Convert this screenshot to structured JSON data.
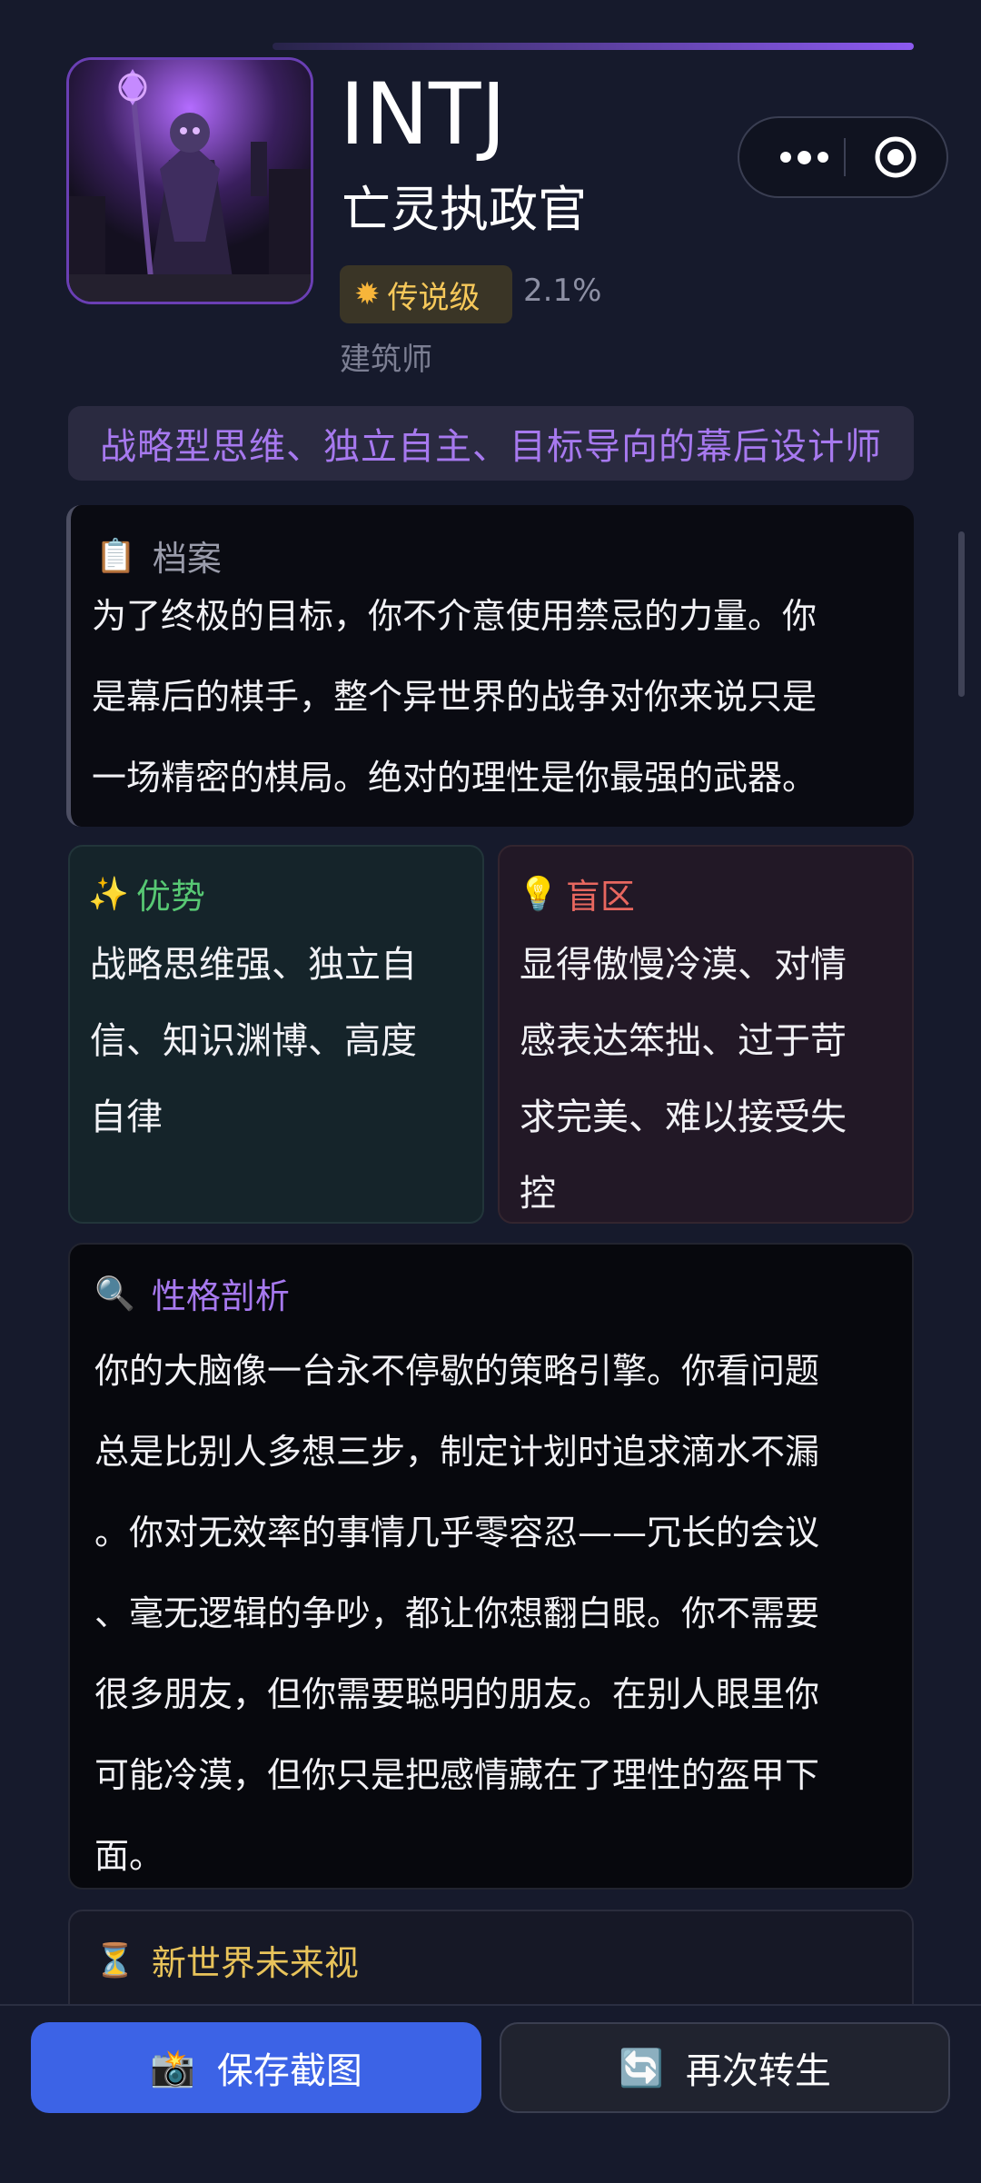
{
  "header": {
    "mbti": "INTJ",
    "title": "亡灵执政官",
    "rarity": {
      "icon": "sun-icon",
      "label": "传说级",
      "color": "#f6c85a"
    },
    "percent": "2.1%",
    "alias": "建筑师"
  },
  "capsule": {
    "more_icon": "more-dots-icon",
    "close_icon": "target-circle-icon"
  },
  "summary": "战略型思维、独立自主、目标导向的幕后设计师",
  "profile": {
    "icon": "📋",
    "title": "档案",
    "lines": [
      "为了终极的目标，你不介意使用禁忌的力量。你",
      "是幕后的棋手，整个异世界的战争对你来说只是",
      "一场精密的棋局。绝对的理性是你最强的武器。"
    ]
  },
  "strengths": {
    "icon": "✨",
    "title": "优势",
    "color": "#57c873",
    "lines": [
      "战略思维强、独立自",
      "信、知识渊博、高度",
      "自律"
    ]
  },
  "blindspots": {
    "icon": "💡",
    "title": "盲区",
    "color": "#e8675f",
    "lines": [
      "显得傲慢冷漠、对情",
      "感表达笨拙、过于苛",
      "求完美、难以接受失",
      "控"
    ]
  },
  "analysis": {
    "icon": "🔍",
    "title": "性格剖析",
    "color": "#a779ef",
    "lines": [
      "你的大脑像一台永不停歇的策略引擎。你看问题",
      "总是比别人多想三步，制定计划时追求滴水不漏",
      "。你对无效率的事情几乎零容忍——冗长的会议",
      "、毫无逻辑的争吵，都让你想翻白眼。你不需要",
      "很多朋友，但你需要聪明的朋友。在别人眼里你",
      "可能冷漠，但你只是把感情藏在了理性的盔甲下",
      "面。"
    ]
  },
  "future": {
    "icon": "⏳",
    "title": "新世界未来视",
    "color": "#e8c35a"
  },
  "buttons": {
    "save": {
      "icon": "📸",
      "label": "保存截图"
    },
    "reborn": {
      "icon": "🔄",
      "label": "再次转生"
    }
  },
  "colors": {
    "accent": "#8c5af0",
    "primary_button": "#3c63e6",
    "background": "#161a2c"
  }
}
